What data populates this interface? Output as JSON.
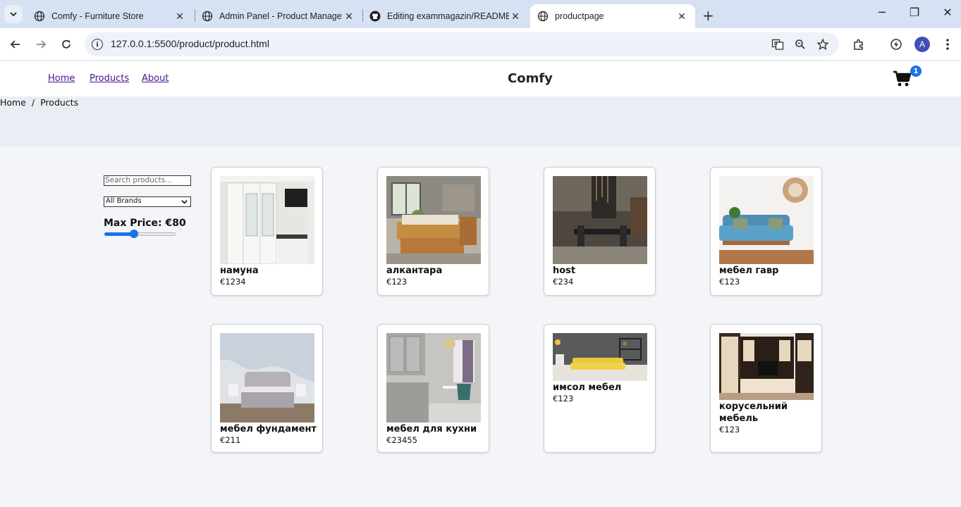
{
  "browser": {
    "tabs": [
      {
        "title": "Comfy - Furniture Store",
        "active": false
      },
      {
        "title": "Admin Panel - Product Manage",
        "active": false
      },
      {
        "title": "Editing exammagazin/README.",
        "active": false
      },
      {
        "title": "productpage",
        "active": true
      }
    ],
    "url": "127.0.0.1:5500/product/product.html",
    "profile_initial": "A"
  },
  "header": {
    "nav": [
      {
        "label": "Home"
      },
      {
        "label": "Products"
      },
      {
        "label": "About"
      }
    ],
    "brand": "Comfy",
    "cart_count": "1"
  },
  "breadcrumb": {
    "home": "Home",
    "separator": "/",
    "current": "Products"
  },
  "filters": {
    "search_placeholder": "Search products...",
    "brand_selected": "All Brands",
    "max_price_label": "Max Price: €80",
    "max_price_fraction": 0.42
  },
  "products": [
    {
      "name": "намуна",
      "price": "€1234"
    },
    {
      "name": "алкантара",
      "price": "€123"
    },
    {
      "name": "host",
      "price": "€234"
    },
    {
      "name": "мебел гавр",
      "price": "€123"
    },
    {
      "name": "мебел фундамент",
      "price": "€211"
    },
    {
      "name": "мебел для кухни",
      "price": "€23455"
    },
    {
      "name": "имсол мебел",
      "price": "€123"
    },
    {
      "name": "корусельний мебель",
      "price": "€123"
    }
  ],
  "colors": {
    "accent": "#1a73e8",
    "link": "#4a148c",
    "page_bg": "#f3f5f9"
  }
}
